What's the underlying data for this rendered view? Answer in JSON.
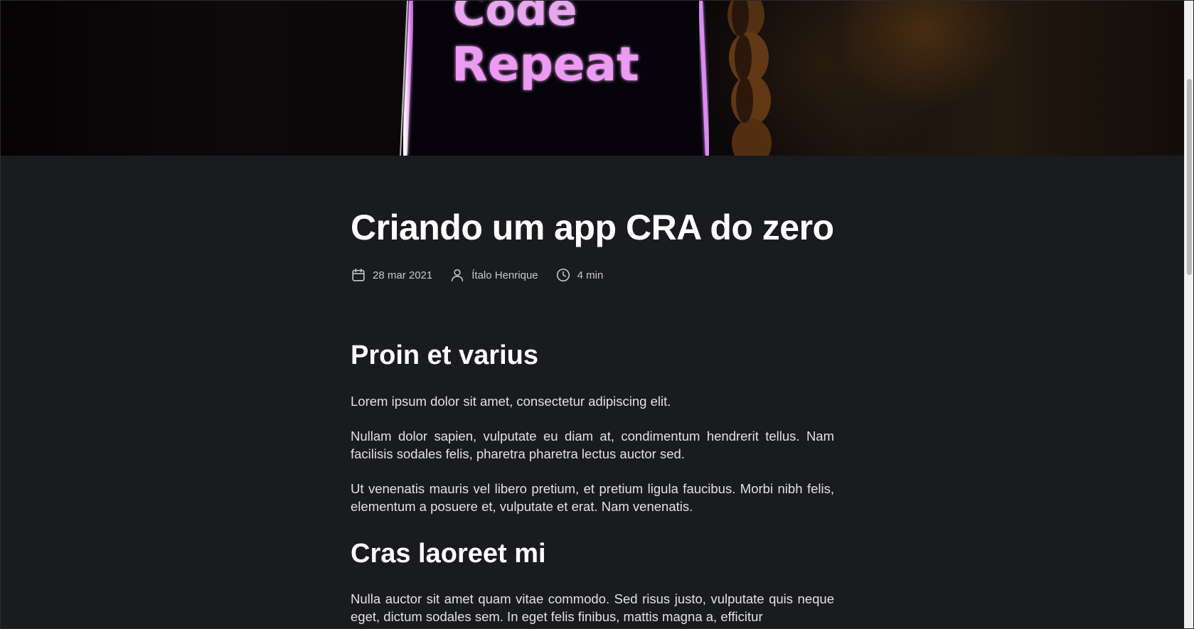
{
  "hero": {
    "image_text_line1": "Code",
    "image_text_line2": "Repeat",
    "accent": "#e58cf0"
  },
  "post": {
    "title": "Criando um app CRA do zero",
    "meta": {
      "date": "28 mar 2021",
      "author": "Ítalo Henrique",
      "reading_time": "4 min"
    },
    "sections": [
      {
        "heading": "Proin et varius",
        "paragraphs": [
          "Lorem ipsum dolor sit amet, consectetur adipiscing elit.",
          "Nullam dolor sapien, vulputate eu diam at, condimentum hendrerit tellus. Nam facilisis sodales felis, pharetra pharetra lectus auctor sed.",
          "Ut venenatis mauris vel libero pretium, et pretium ligula faucibus. Morbi nibh felis, elementum a posuere et, vulputate et erat. Nam venenatis."
        ]
      },
      {
        "heading": "Cras laoreet mi",
        "paragraphs": [
          "Nulla auctor sit amet quam vitae commodo. Sed risus justo, vulputate quis neque eget, dictum sodales sem. In eget felis finibus, mattis magna a, efficitur"
        ]
      }
    ]
  },
  "colors": {
    "background": "#1a1b1f",
    "title": "#ffffff",
    "body_text": "#e1e1e6",
    "meta_text": "#c8c9cc"
  },
  "icons": {
    "date": "calendar-icon",
    "author": "user-icon",
    "reading_time": "clock-icon"
  }
}
